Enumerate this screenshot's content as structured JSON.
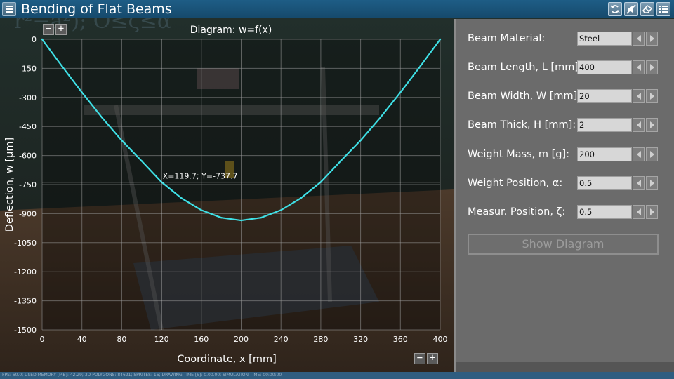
{
  "app": {
    "title": "Bending of Flat Beams"
  },
  "toolbar": {
    "icons": [
      "reset-icon",
      "sound-off-icon",
      "eraser-icon",
      "list-icon"
    ]
  },
  "chart_data": {
    "type": "line",
    "title": "Diagram: w=f(x)",
    "xlabel": "Coordinate, x [mm]",
    "ylabel": "Deflection, w [µm]",
    "xlim": [
      0,
      400
    ],
    "ylim": [
      -1500,
      0
    ],
    "x_ticks": [
      "0",
      "40",
      "80",
      "120",
      "160",
      "200",
      "240",
      "280",
      "320",
      "360",
      "400"
    ],
    "y_ticks": [
      "0",
      "-150",
      "-300",
      "-450",
      "-600",
      "-750",
      "-900",
      "-1050",
      "-1200",
      "-1350",
      "-1500"
    ],
    "grid": true,
    "line_color": "#3fe0e6",
    "series": [
      {
        "x": [
          0,
          20,
          40,
          60,
          80,
          100,
          120,
          140,
          160,
          180,
          200,
          220,
          240,
          260,
          280,
          300,
          320,
          340,
          360,
          380,
          400
        ],
        "values": [
          0,
          -139,
          -274,
          -403,
          -522,
          -628,
          -737,
          -820,
          -882,
          -921,
          -935,
          -921,
          -882,
          -820,
          -737,
          -628,
          -522,
          -403,
          -274,
          -139,
          0
        ]
      }
    ],
    "cursor": {
      "x": 119.7,
      "y": -737.7,
      "label": "X=119.7; Y=-737.7"
    }
  },
  "chart_controls": {
    "zoom_out": "−",
    "zoom_in": "+"
  },
  "panel": {
    "rows": [
      {
        "label": "Beam Material:",
        "value": "Steel"
      },
      {
        "label": "Beam Length, L [mm]:",
        "value": "400"
      },
      {
        "label": "Beam Width, W [mm]:",
        "value": "20"
      },
      {
        "label": "Beam Thick, H [mm]:",
        "value": "2"
      },
      {
        "label": "Weight Mass, m [g]:",
        "value": "200"
      },
      {
        "label": "Weight Position, α:",
        "value": "0.5"
      },
      {
        "label": "Measur. Position, ζ:",
        "value": "0.5"
      }
    ],
    "show_diagram": "Show Diagram"
  },
  "status": {
    "text": "FPS: 60.0; USED MEMORY [MB]: 42.29; 3D POLYGONS: 84621; SPRITES: 16; DRAWING TIME [S]: 0.00.00; SIMULATION TIME: 00:00:00"
  }
}
